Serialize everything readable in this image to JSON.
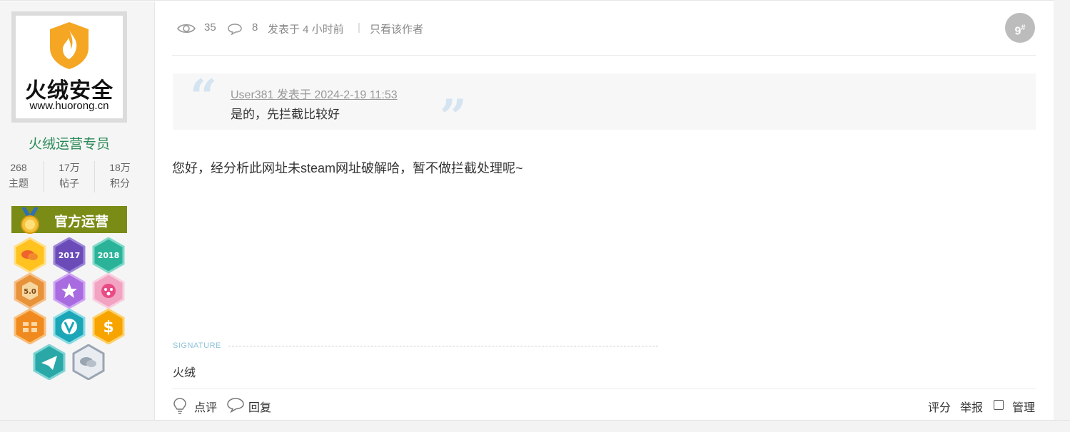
{
  "author": {
    "avatar": {
      "logo_text": "火绒安全",
      "logo_url": "www.huorong.cn"
    },
    "name": "火绒运营专员",
    "stats": [
      {
        "value": "268",
        "label": "主题"
      },
      {
        "value": "17万",
        "label": "帖子"
      },
      {
        "value": "18万",
        "label": "积分"
      }
    ],
    "role_badge": "官方运营",
    "medal_labels": [
      "2017",
      "2018",
      "5.0"
    ],
    "medals": [
      "chat-medal",
      "2017-medal",
      "2018-medal",
      "five-medal",
      "star-medal",
      "pink-face-medal",
      "gift-medal",
      "vip-medal",
      "coin-medal",
      "paper-plane-medal",
      "grey-chat-medal"
    ]
  },
  "post": {
    "views": "35",
    "replies": "8",
    "posted_time": "发表于 4 小时前",
    "separator": "|",
    "only_author_link": "只看该作者",
    "floor_number": "9",
    "floor_suffix": "#",
    "quote": {
      "header": "User381 发表于 2024-2-19 11:53",
      "body": "是的，先拦截比较好"
    },
    "content": "您好，经分析此网址未steam网址破解哈，暂不做拦截处理呢~",
    "signature_label": "SIGNATURE",
    "signature_text": "火绒"
  },
  "actions": {
    "comment_label": "点评",
    "reply_label": "回复",
    "rate_label": "评分",
    "report_label": "举报",
    "manage_label": "管理"
  }
}
